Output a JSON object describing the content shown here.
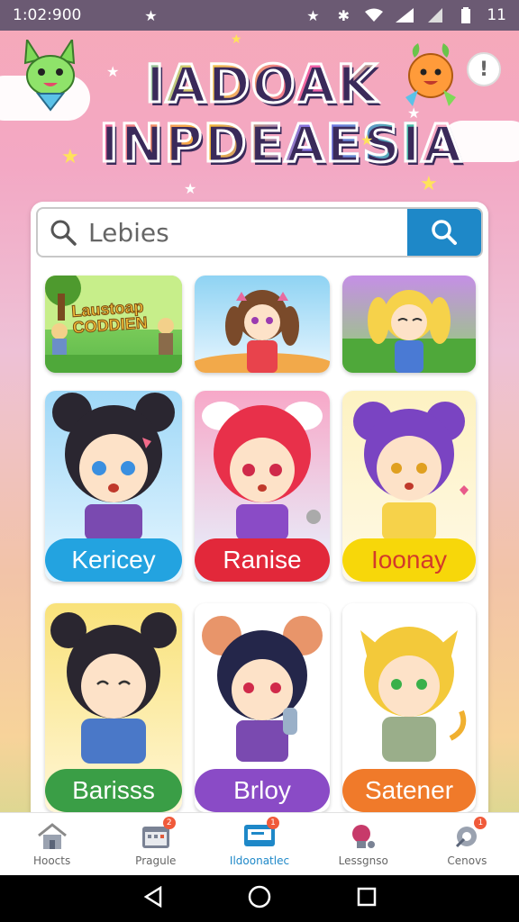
{
  "status_bar": {
    "time": "1:02:900",
    "battery": "11"
  },
  "header": {
    "logo_line1": "IADOAK",
    "logo_line2": "INPDEAESIA",
    "info_button": "!"
  },
  "search": {
    "placeholder": "Lebies"
  },
  "banner": {
    "text_line1": "Laustoap",
    "text_line2": "CODDIEN"
  },
  "characters": [
    {
      "name": "Kericey",
      "color": "#23a3e0"
    },
    {
      "name": "Ranise",
      "color": "#e2283a"
    },
    {
      "name": "Ioonay",
      "color": "#f7d70a"
    },
    {
      "name": "Barisss",
      "color": "#3a9e46"
    },
    {
      "name": "Brloy",
      "color": "#8a4bc6"
    },
    {
      "name": "Satener",
      "color": "#f07a2a"
    }
  ],
  "bottom_nav": [
    {
      "label": "Hoocts",
      "icon": "home-icon",
      "badge": ""
    },
    {
      "label": "Pragule",
      "icon": "calendar-icon",
      "badge": "2"
    },
    {
      "label": "Ildoonatlec",
      "icon": "monitor-icon",
      "badge": "1",
      "active": true
    },
    {
      "label": "Lessgnso",
      "icon": "record-icon",
      "badge": ""
    },
    {
      "label": "Cenovs",
      "icon": "settings-icon",
      "badge": "1"
    }
  ]
}
